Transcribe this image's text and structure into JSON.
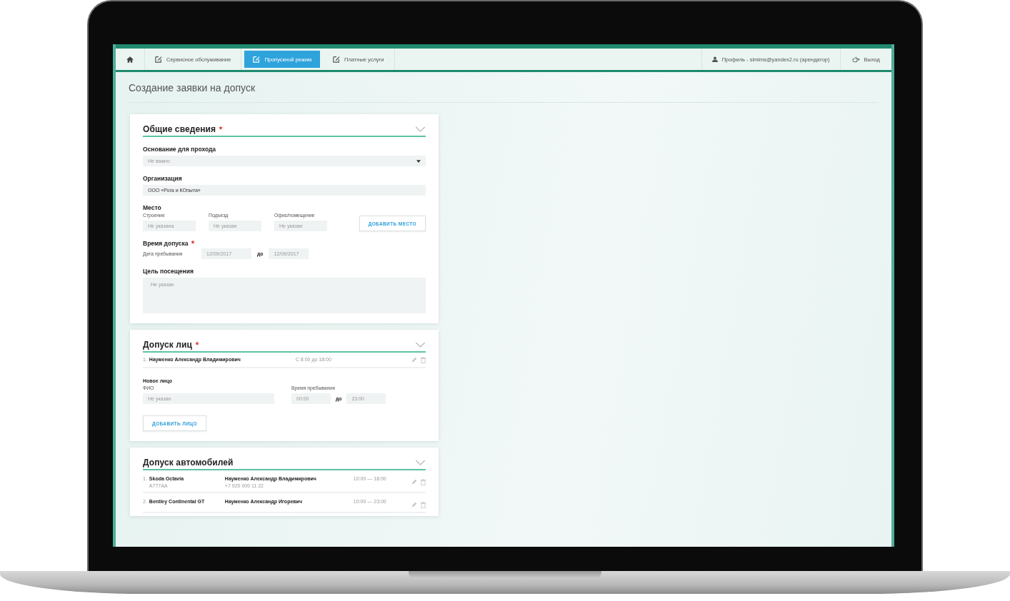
{
  "nav": {
    "tabs": [
      {
        "kind": "home",
        "selected": false
      },
      {
        "kind": "edit",
        "label": "Сервисное обслуживание",
        "selected": false
      },
      {
        "kind": "edit",
        "label": "Пропускной режим",
        "selected": true
      },
      {
        "kind": "edit",
        "label": "Платные услуги",
        "selected": false
      }
    ],
    "user_links": [
      {
        "kind": "profile",
        "label": "Профиль - simims@yandex2.ru (арендатор)"
      },
      {
        "kind": "logout",
        "label": "Выход"
      }
    ]
  },
  "page_title": "Создание заявки на допуск",
  "sections": [
    {
      "kind": "general",
      "title": "Общие сведения",
      "required": true,
      "basis": {
        "label": "Основание для прохода",
        "value": "Не важно"
      },
      "organization": {
        "label": "Организация",
        "value": "ООО «Рога и КОпыта»"
      },
      "place": {
        "label": "Место",
        "fields": [
          {
            "label": "Строение",
            "placeholder": "Не указана"
          },
          {
            "label": "Подъезд",
            "placeholder": "Не указан"
          },
          {
            "label": "Офис/помещение",
            "placeholder": "Не указан"
          }
        ],
        "button": "ДОБАВИТЬ МЕСТО"
      },
      "time": {
        "label": "Время допуска",
        "required": true,
        "sublabel": "Дата пребывания",
        "from": "12/09/2017",
        "separator": "до",
        "to": "12/09/2017"
      },
      "purpose": {
        "label": "Цель посещения",
        "placeholder": "Не указан"
      }
    },
    {
      "kind": "people",
      "title": "Допуск лиц",
      "required": true,
      "entries": [
        {
          "number": "1.",
          "name": "Науменко Александр Владимирович",
          "time": "С 8:00 до 18:00"
        }
      ],
      "new_person": {
        "heading": "Новое лицо",
        "name_label": "ФИО",
        "name_placeholder": "Не указан",
        "time_label": "Время пребывания",
        "from": "00:00",
        "separator": "до",
        "to": "23:00"
      },
      "button": "ДОБАВИТЬ ЛИЦО"
    },
    {
      "kind": "cars",
      "title": "Допуск автомобилей",
      "required": false,
      "entries": [
        {
          "number": "1.",
          "car": "Skoda Octavia",
          "plate": "А777АА",
          "person": "Науменко Александр Владимирович",
          "phone": "+7 920 000 11 22",
          "time": "10:00 — 18:00"
        },
        {
          "number": "2.",
          "car": "Bentley Continental GT",
          "person": "Науменко Александр Игоревич",
          "time": "10:00 — 23:00"
        }
      ]
    }
  ]
}
